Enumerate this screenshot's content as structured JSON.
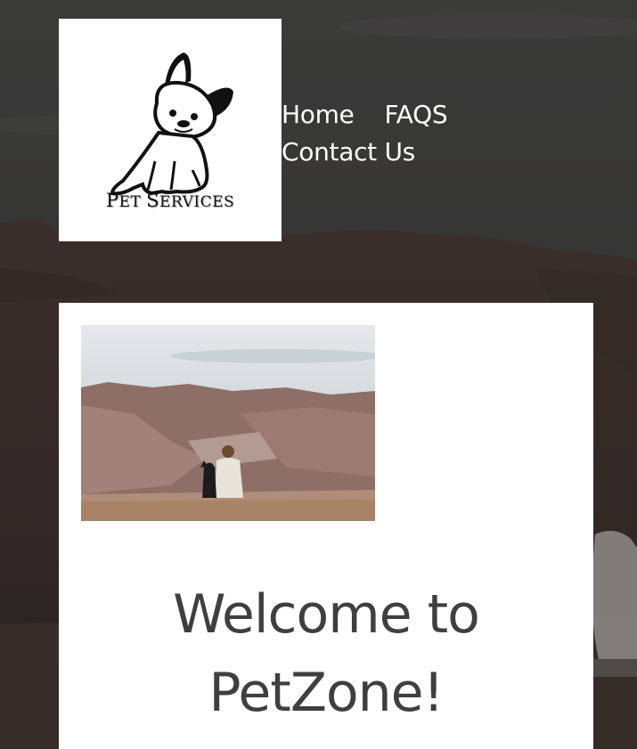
{
  "logo": {
    "text_first_big": "P",
    "text_first_rest": "ET ",
    "text_second_big": "S",
    "text_second_rest": "ERVICES"
  },
  "nav": {
    "items": [
      {
        "label": "Home"
      },
      {
        "label": "FAQS"
      },
      {
        "label": "Contact Us"
      }
    ]
  },
  "main": {
    "heading": "Welcome to PetZone!",
    "photo_icon": "canyon-person-dog-photo"
  },
  "colors": {
    "nav_text": "#ffffff",
    "heading_text": "#3f3f3f",
    "panel_bg": "#ffffff"
  }
}
